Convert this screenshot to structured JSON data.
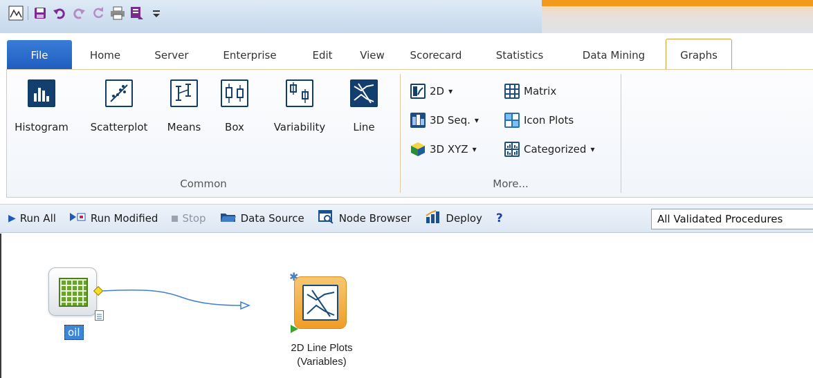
{
  "quick_access": {
    "icons": [
      "app-icon",
      "save-icon",
      "undo-icon",
      "redo-icon",
      "refresh-icon",
      "print-icon",
      "customize-icon",
      "dropdown-icon"
    ]
  },
  "tabs": [
    {
      "label": "File"
    },
    {
      "label": "Home"
    },
    {
      "label": "Server"
    },
    {
      "label": "Enterprise"
    },
    {
      "label": "Edit"
    },
    {
      "label": "View"
    },
    {
      "label": "Scorecard"
    },
    {
      "label": "Statistics"
    },
    {
      "label": "Data Mining"
    },
    {
      "label": "Graphs"
    }
  ],
  "ribbon": {
    "common": {
      "label": "Common",
      "buttons": [
        {
          "label": "Histogram"
        },
        {
          "label": "Scatterplot"
        },
        {
          "label": "Means"
        },
        {
          "label": "Box"
        },
        {
          "label": "Variability"
        },
        {
          "label": "Line"
        }
      ]
    },
    "more": {
      "label": "More...",
      "buttons": [
        {
          "label": "2D",
          "dropdown": "▾"
        },
        {
          "label": "3D Seq.",
          "dropdown": "▾"
        },
        {
          "label": "3D XYZ",
          "dropdown": "▾"
        },
        {
          "label": "Matrix"
        },
        {
          "label": "Icon Plots"
        },
        {
          "label": "Categorized",
          "dropdown": "▾"
        }
      ]
    }
  },
  "toolbar": {
    "run_all": "Run All",
    "run_modified": "Run Modified",
    "stop": "Stop",
    "data_source": "Data Source",
    "node_browser": "Node Browser",
    "deploy": "Deploy",
    "help": "?",
    "procedures_select": "All Validated Procedures"
  },
  "canvas": {
    "source_node_label": "oil",
    "target_node_label_line1": "2D Line Plots",
    "target_node_label_line2": "(Variables)"
  },
  "colors": {
    "file_tab": "#1e5cbd",
    "active_tab_border": "#e09a3a",
    "node_green": "#6aa329",
    "node_orange": "#ef9e27",
    "link_blue": "#3b86d8"
  }
}
